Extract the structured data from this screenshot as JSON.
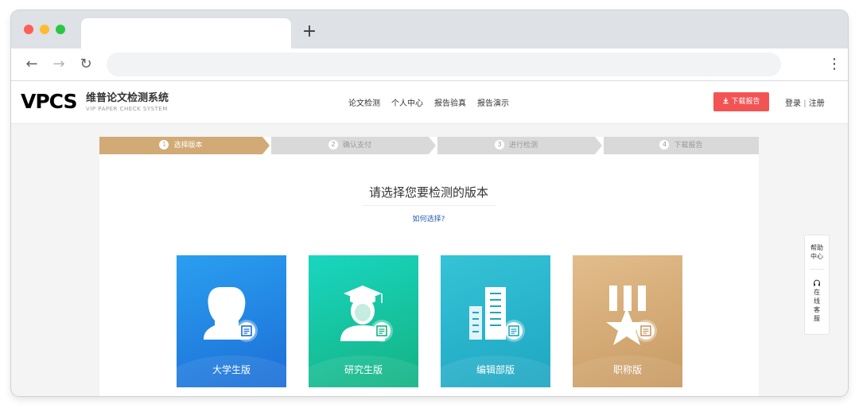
{
  "site": {
    "logo": "VPCS",
    "name": "维普论文检测系统",
    "subtitle": "VIP PAPER CHECK SYSTEM"
  },
  "nav": [
    "论文检测",
    "个人中心",
    "报告验真",
    "报告演示"
  ],
  "header": {
    "download_btn": "下载报告",
    "login": "登录",
    "separator": "|",
    "register": "注册"
  },
  "steps": [
    {
      "num": "1",
      "label": "选择版本",
      "active": true
    },
    {
      "num": "2",
      "label": "确认支付",
      "active": false
    },
    {
      "num": "3",
      "label": "进行检测",
      "active": false
    },
    {
      "num": "4",
      "label": "下载报告",
      "active": false
    }
  ],
  "main": {
    "heading": "请选择您要检测的版本",
    "howto": "如何选择?"
  },
  "cards": [
    {
      "label": "大学生版",
      "color_top": "#2a9ff0",
      "color_bottom": "#1c6ed6",
      "icon": "student-icon"
    },
    {
      "label": "研究生版",
      "color_top": "#19d6c0",
      "color_bottom": "#14b282",
      "icon": "graduate-icon"
    },
    {
      "label": "编辑部版",
      "color_top": "#35c3d6",
      "color_bottom": "#1ea6c2",
      "icon": "building-icon"
    },
    {
      "label": "职称版",
      "color_top": "#e2bd8c",
      "color_bottom": "#c89a62",
      "icon": "medal-icon"
    }
  ],
  "help": {
    "center": "帮助中心",
    "service": "在线客服"
  }
}
